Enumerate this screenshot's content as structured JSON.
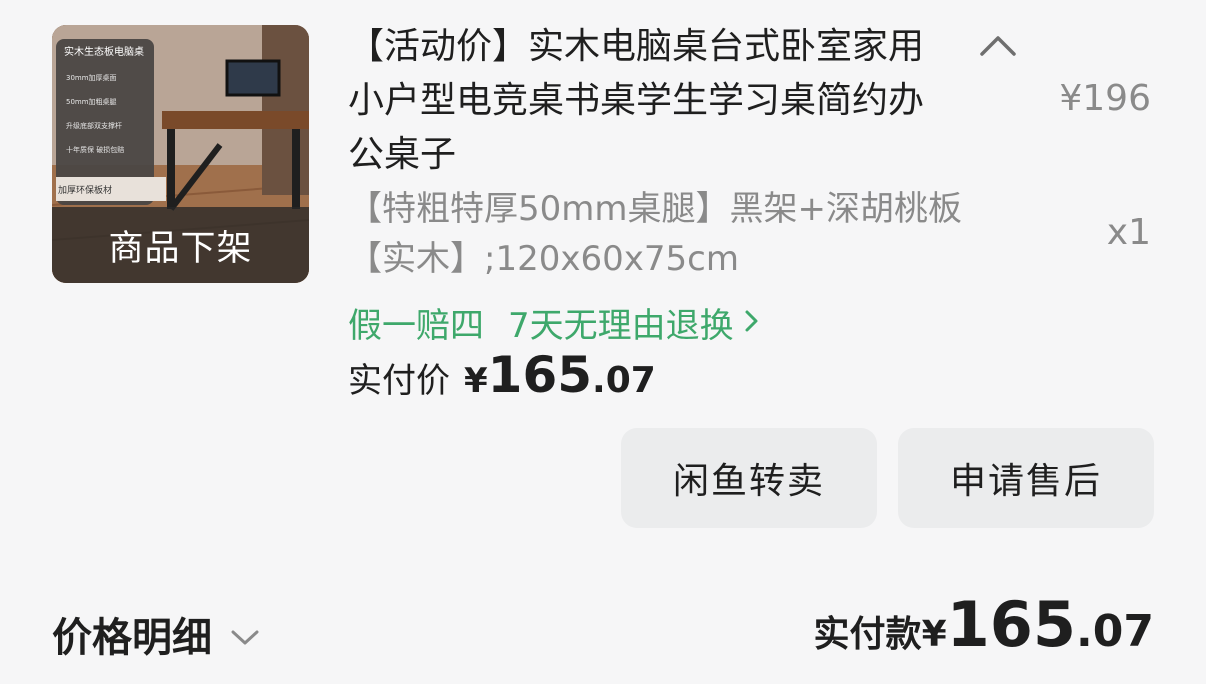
{
  "product": {
    "image_overlay": "商品下架",
    "image_badge_text": "实木生态板电脑桌",
    "image_feature_1": "30mm加厚桌面",
    "image_feature_2": "50mm加粗桌腿",
    "image_feature_3": "升级底部双支撑杆",
    "image_feature_4": "十年质保 破损包赔",
    "image_footer_text": "加厚环保板材",
    "title": "【活动价】实木电脑桌台式卧室家用小户型电竞桌书桌学生学习桌简约办公桌子",
    "original_price": "¥196",
    "spec": "【特粗特厚50mm桌腿】黑架+深胡桃板【实木】;120x60x75cm",
    "quantity": "x1",
    "guarantee_1": "假一赔四",
    "guarantee_2": "7天无理由退换",
    "paid_label": "实付价",
    "paid_currency": "¥",
    "paid_integer": "165",
    "paid_decimal": ".07"
  },
  "actions": {
    "resell_label": "闲鱼转卖",
    "after_sale_label": "申请售后"
  },
  "footer": {
    "price_detail_label": "价格明细",
    "total_label": "实付款",
    "total_currency": "¥",
    "total_integer": "165",
    "total_decimal": ".07"
  },
  "colors": {
    "background": "#f6f6f7",
    "guarantee_green": "#3ea86b",
    "button_bg": "#ebeced",
    "muted_text": "#8a8a8a"
  },
  "icons": {
    "collapse": "chevron-up-icon",
    "guarantee_arrow": "chevron-right-icon",
    "price_detail_arrow": "chevron-down-icon"
  }
}
